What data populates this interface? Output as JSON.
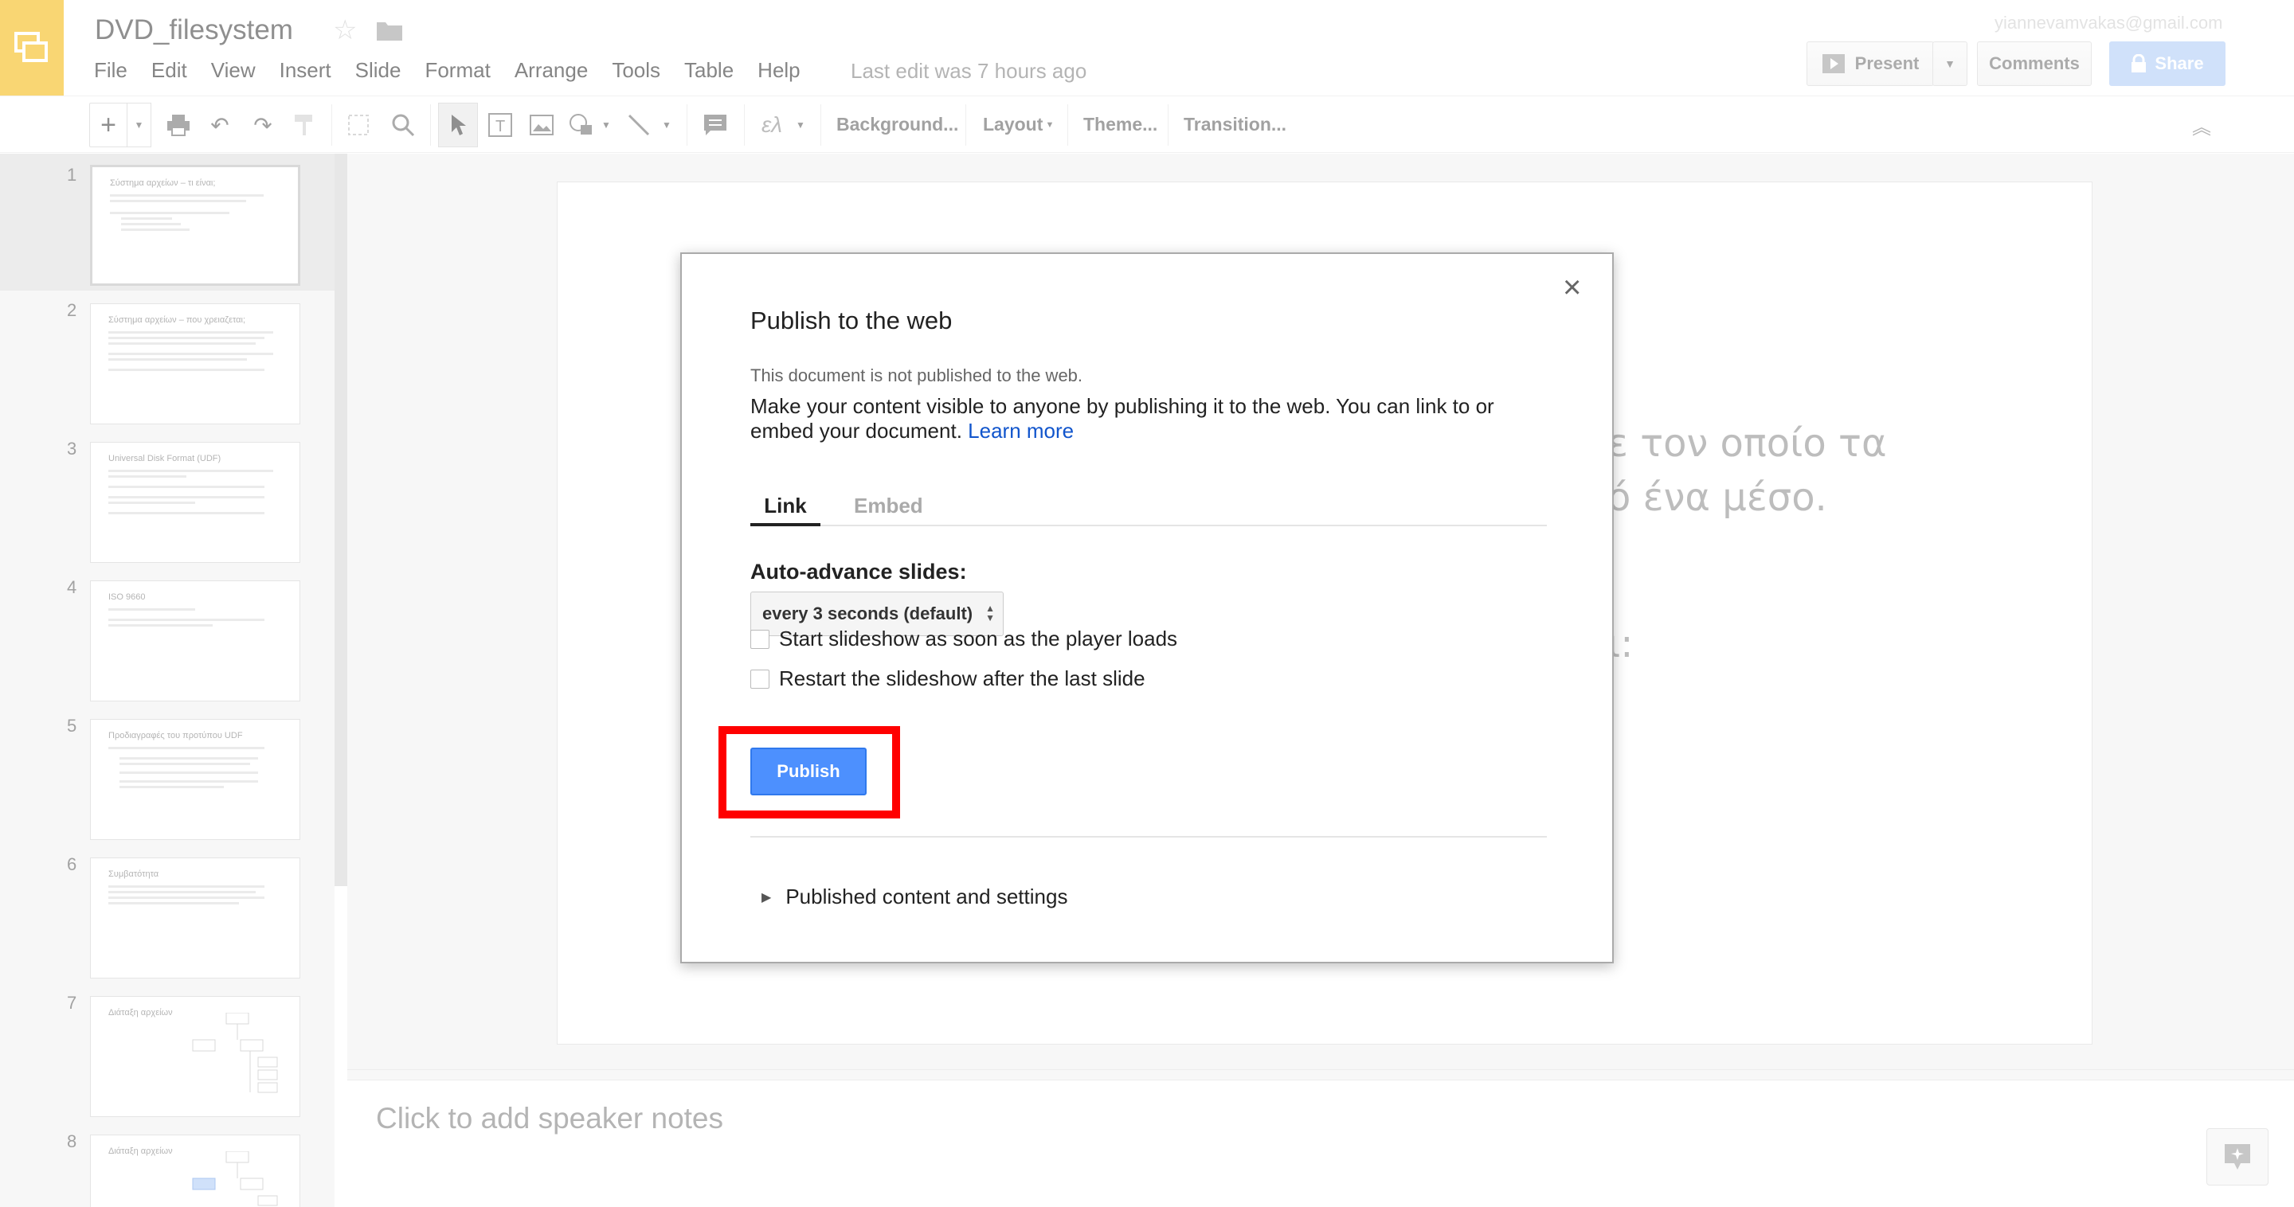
{
  "header": {
    "doc_title": "DVD_filesystem",
    "account": "yiannevamvakas@gmail.com",
    "last_edit": "Last edit was 7 hours ago",
    "present_label": "Present",
    "comments_label": "Comments",
    "share_label": "Share"
  },
  "menu": [
    "File",
    "Edit",
    "View",
    "Insert",
    "Slide",
    "Format",
    "Arrange",
    "Tools",
    "Table",
    "Help"
  ],
  "toolbar": {
    "background_label": "Background...",
    "layout_label": "Layout",
    "theme_label": "Theme...",
    "transition_label": "Transition...",
    "lang_label": "ελ"
  },
  "filmstrip": {
    "slides": [
      {
        "num": "1",
        "title": "Σύστημα αρχείων – τι είναι;"
      },
      {
        "num": "2",
        "title": "Σύστημα αρχείων – που χρειαζεται;"
      },
      {
        "num": "3",
        "title": "Universal Disk Format (UDF)"
      },
      {
        "num": "4",
        "title": "ISO 9660"
      },
      {
        "num": "5",
        "title": "Προδιαγραφές του προτύπου UDF"
      },
      {
        "num": "6",
        "title": "Συμβατότητα"
      },
      {
        "num": "7",
        "title": "Διάταξη αρχείων"
      },
      {
        "num": "8",
        "title": "Διάταξη αρχείων"
      }
    ]
  },
  "slide_canvas": {
    "partial_line_1": "ε τον οποίο τα",
    "partial_line_2": "ό ένα μέσο.",
    "partial_line_3": "ι:"
  },
  "notes": {
    "placeholder": "Click to add speaker notes"
  },
  "dialog": {
    "title": "Publish to the web",
    "close_symbol": "×",
    "status": "This document is not published to the web.",
    "description": "Make your content visible to anyone by publishing it to the web. You can link to or embed your document.",
    "learn_more": "Learn more",
    "tab_link": "Link",
    "tab_embed": "Embed",
    "auto_advance_label": "Auto-advance slides:",
    "auto_advance_value": "every 3 seconds (default)",
    "check_start": "Start slideshow as soon as the player loads",
    "check_restart": "Restart the slideshow after the last slide",
    "publish_label": "Publish",
    "published_settings": "Published content and settings"
  },
  "colors": {
    "brand": "#f4b400",
    "publish": "#4d90fe",
    "highlight": "#ff0000",
    "share": "#a9c8f6"
  }
}
